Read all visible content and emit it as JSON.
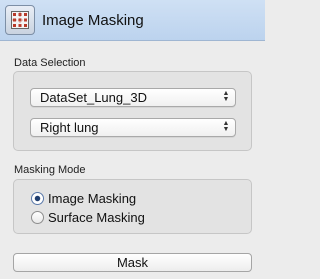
{
  "header": {
    "title": "Image Masking",
    "icon": "mask-grid-icon"
  },
  "data_selection": {
    "label": "Data Selection",
    "dataset": {
      "value": "DataSet_Lung_3D"
    },
    "mask": {
      "value": "Right lung"
    }
  },
  "masking_mode": {
    "label": "Masking Mode",
    "options": [
      {
        "label": "Image Masking",
        "checked": true
      },
      {
        "label": "Surface Masking",
        "checked": false
      }
    ]
  },
  "actions": {
    "mask_label": "Mask"
  },
  "colors": {
    "header_bg": "#c5daf1",
    "accent_radio": "#1f3d6e"
  }
}
